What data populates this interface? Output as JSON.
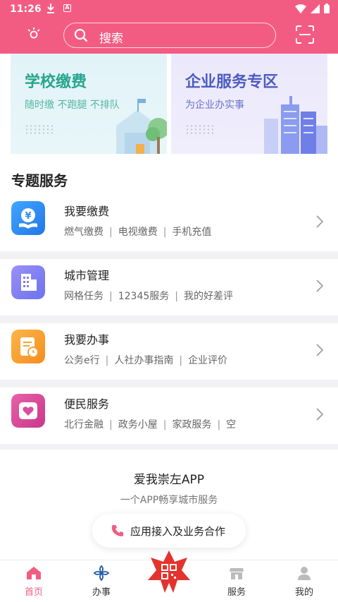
{
  "status_bar": {
    "time": "11:26",
    "a_icon": "A"
  },
  "search": {
    "placeholder": "搜索"
  },
  "banners": [
    {
      "title": "学校缴费",
      "subtitle": "随时缴 不跑腿 不排队"
    },
    {
      "title": "企业服务专区",
      "subtitle": "为企业办实事"
    }
  ],
  "section_title": "专题服务",
  "services": [
    {
      "title": "我要缴费",
      "items": [
        "燃气缴费",
        "电视缴费",
        "手机充值"
      ],
      "icon": "yuan-hand-icon",
      "color": "#2f8df3"
    },
    {
      "title": "城市管理",
      "items": [
        "网格任务",
        "12345服务",
        "我的好差评"
      ],
      "icon": "building-icon",
      "color": "#7f7ff2"
    },
    {
      "title": "我要办事",
      "items": [
        "公务e行",
        "人社办事指南",
        "企业评价"
      ],
      "icon": "document-clock-icon",
      "color": "#f8a12e"
    },
    {
      "title": "便民服务",
      "items": [
        "北行金融",
        "政务小屋",
        "家政服务",
        "空"
      ],
      "icon": "heart-icon",
      "color": "#d94f9b"
    }
  ],
  "footer": {
    "title": "爱我崇左APP",
    "subtitle": "一个APP畅享城市服务",
    "button_label": "应用接入及业务合作"
  },
  "tabs": [
    {
      "label": "首页",
      "icon": "home-icon",
      "active": true
    },
    {
      "label": "办事",
      "icon": "knot-icon",
      "active": false
    },
    {
      "label": "",
      "icon": "qr-flower-icon",
      "active": false
    },
    {
      "label": "服务",
      "icon": "shop-icon",
      "active": false
    },
    {
      "label": "我的",
      "icon": "user-icon",
      "active": false
    }
  ],
  "colors": {
    "header": "#f35c82",
    "accent": "#f35c82"
  }
}
